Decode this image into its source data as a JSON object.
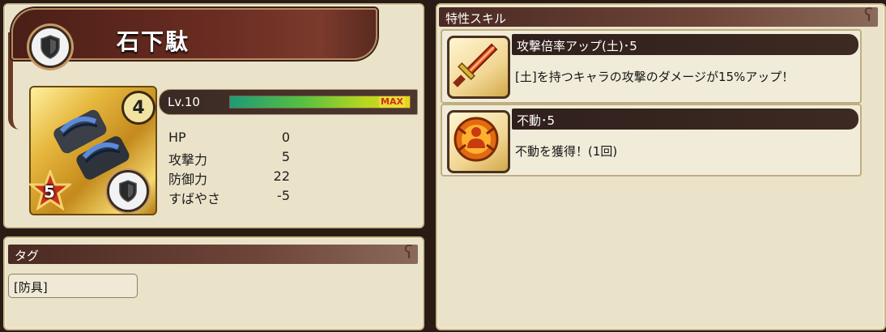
{
  "item": {
    "name": "石下駄",
    "rank": "4",
    "stars": "5",
    "level_label": "Lv.10",
    "level_max_label": "MAX",
    "level_progress": 1.0
  },
  "stats": [
    {
      "label": "HP",
      "value": "0"
    },
    {
      "label": "攻撃力",
      "value": "5"
    },
    {
      "label": "防御力",
      "value": "22"
    },
    {
      "label": "すばやさ",
      "value": "-5"
    }
  ],
  "tags": {
    "header": "タグ",
    "items": [
      "[防具]"
    ]
  },
  "skills": {
    "header": "特性スキル",
    "items": [
      {
        "title": "攻撃倍率アップ(土)･5",
        "description": "[土]を持つキャラの攻撃のダメージが15%アップ！",
        "icon": "sword-icon"
      },
      {
        "title": "不動･5",
        "description": "不動を獲得！(1回)",
        "icon": "immovable-icon"
      }
    ]
  },
  "colors": {
    "panel_bg": "#ebe3c9",
    "header_bg": "#4a2a22",
    "bar_start": "#1f9a78",
    "bar_end": "#e6d818"
  }
}
